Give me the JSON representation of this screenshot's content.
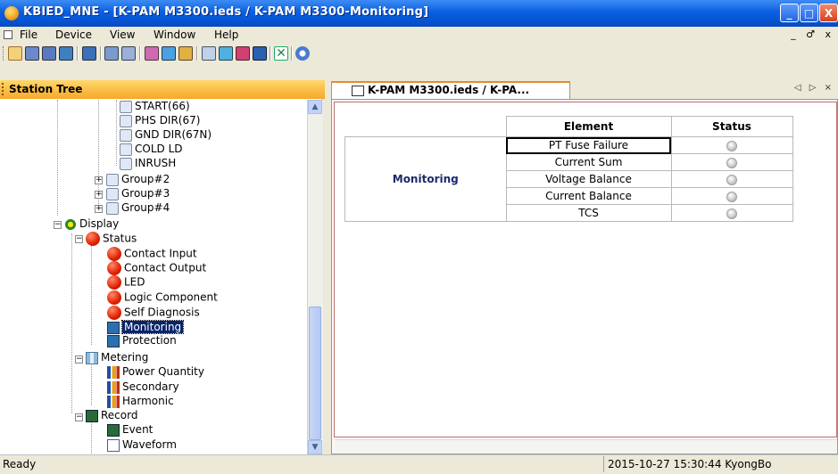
{
  "window": {
    "title": "KBIED_MNE - [K-PAM M3300.ieds / K-PAM M3300-Monitoring]",
    "controls": {
      "minimize": "_",
      "restore": "□",
      "close": "X"
    }
  },
  "menu": {
    "items": [
      "File",
      "Device",
      "View",
      "Window",
      "Help"
    ],
    "mdi_controls": "_ ♂ x"
  },
  "toolbar": {
    "icons": [
      "new-icon",
      "save-icon",
      "save-all-icon",
      "properties-icon",
      "tree-icon",
      "connect-icon",
      "disconnect-icon",
      "read-icon",
      "write-icon",
      "table-icon",
      "form-icon",
      "edit-icon",
      "edit2-icon",
      "export-icon",
      "delete-icon",
      "help-icon"
    ]
  },
  "station_tree": {
    "header": "Station Tree",
    "nodes": {
      "start": "START(66)",
      "phs_dir": "PHS DIR(67)",
      "gnd_dir": "GND DIR(67N)",
      "cold_ld": "COLD LD",
      "inrush": "INRUSH",
      "group2": "Group#2",
      "group3": "Group#3",
      "group4": "Group#4",
      "display": "Display",
      "status": "Status",
      "contact_input": "Contact Input",
      "contact_output": "Contact Output",
      "led": "LED",
      "logic_component": "Logic Component",
      "self_diagnosis": "Self Diagnosis",
      "monitoring": "Monitoring",
      "protection": "Protection",
      "metering": "Metering",
      "power_quantity": "Power Quantity",
      "secondary": "Secondary",
      "harmonic": "Harmonic",
      "record": "Record",
      "event": "Event",
      "waveform": "Waveform"
    }
  },
  "tab": {
    "label": "K-PAM M3300.ieds / K-PA...",
    "nav": "◁ ▷ ×"
  },
  "monitoring_table": {
    "headers": {
      "element": "Element",
      "status": "Status"
    },
    "group_label": "Monitoring",
    "rows": [
      "PT Fuse Failure",
      "Current Sum",
      "Voltage Balance",
      "Current Balance",
      "TCS"
    ]
  },
  "statusbar": {
    "left": "Ready",
    "right": "2015-10-27 15:30:44  KyongBo"
  },
  "colors": {
    "title_blue": "#0a5fe0",
    "header_orange": "#f7a72a",
    "tab_accent": "#e68b2c",
    "selected": "#0a246a"
  }
}
